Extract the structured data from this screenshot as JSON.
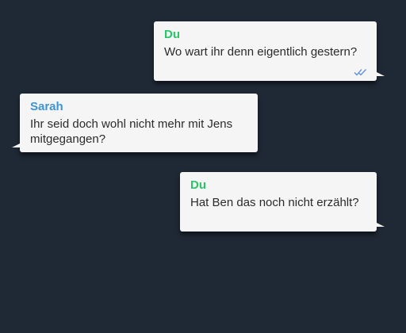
{
  "conversation": {
    "messages": [
      {
        "sender": "Du",
        "text": "Wo wart ihr denn eigentlich gestern?",
        "direction": "outgoing",
        "status_icon": "double-check-icon"
      },
      {
        "sender": "Sarah",
        "text": "Ihr seid doch wohl nicht mehr mit Jens mitgegangen?",
        "direction": "incoming"
      },
      {
        "sender": "Du",
        "text": "Hat Ben das noch nicht erzählt?",
        "direction": "outgoing"
      }
    ]
  },
  "colors": {
    "background": "#1f2936",
    "bubble": "#f5f5f5",
    "sender_self": "#2ec26a",
    "sender_other": "#3d95d3",
    "read_receipt": "#5b8de0"
  }
}
